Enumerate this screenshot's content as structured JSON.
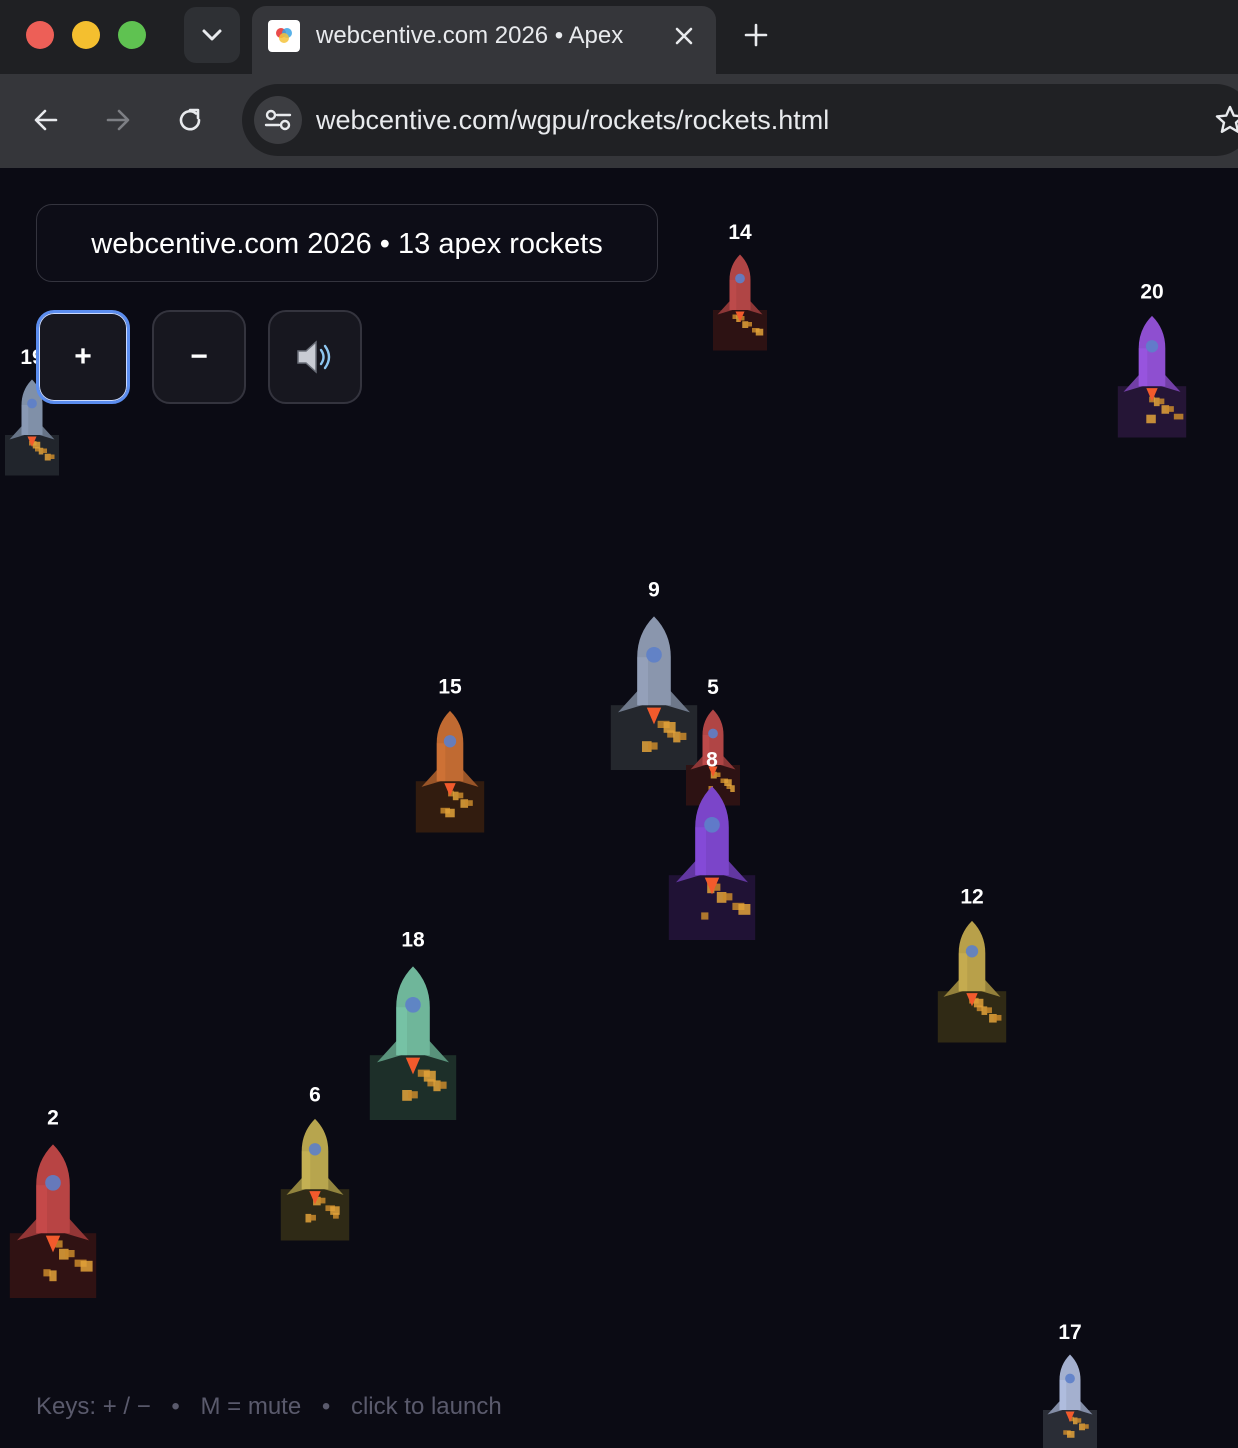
{
  "browser": {
    "tab_title": "webcentive.com 2026 • Apex",
    "new_tab_label": "+",
    "url": "webcentive.com/wgpu/rockets/rockets.html"
  },
  "app": {
    "title": "webcentive.com 2026 • 13 apex rockets",
    "buttons": {
      "plus": "+",
      "minus": "−",
      "mute_icon": "speaker-icon"
    },
    "footer": [
      "Keys: + / −",
      "•",
      "M = mute",
      "•",
      "click to launch"
    ]
  },
  "rockets": [
    {
      "id": "14",
      "label": "14",
      "color": "#b04545",
      "size": "s"
    },
    {
      "id": "20",
      "label": "20",
      "color": "#8e4fd0",
      "size": "m"
    },
    {
      "id": "19",
      "label": "19",
      "color": "#8090a8",
      "size": "s"
    },
    {
      "id": "9",
      "label": "9",
      "color": "#8a96ad",
      "size": "l"
    },
    {
      "id": "5",
      "label": "5",
      "color": "#b04545",
      "size": "s"
    },
    {
      "id": "8",
      "label": "8",
      "color": "#7b45c9",
      "size": "l"
    },
    {
      "id": "15",
      "label": "15",
      "color": "#c06a32",
      "size": "m"
    },
    {
      "id": "12",
      "label": "12",
      "color": "#b8a04a",
      "size": "m"
    },
    {
      "id": "18",
      "label": "18",
      "color": "#6fb69a",
      "size": "l"
    },
    {
      "id": "6",
      "label": "6",
      "color": "#b7a54e",
      "size": "m"
    },
    {
      "id": "2",
      "label": "2",
      "color": "#b84444",
      "size": "l"
    },
    {
      "id": "17",
      "label": "17",
      "color": "#a4b0cf",
      "size": "s"
    }
  ]
}
